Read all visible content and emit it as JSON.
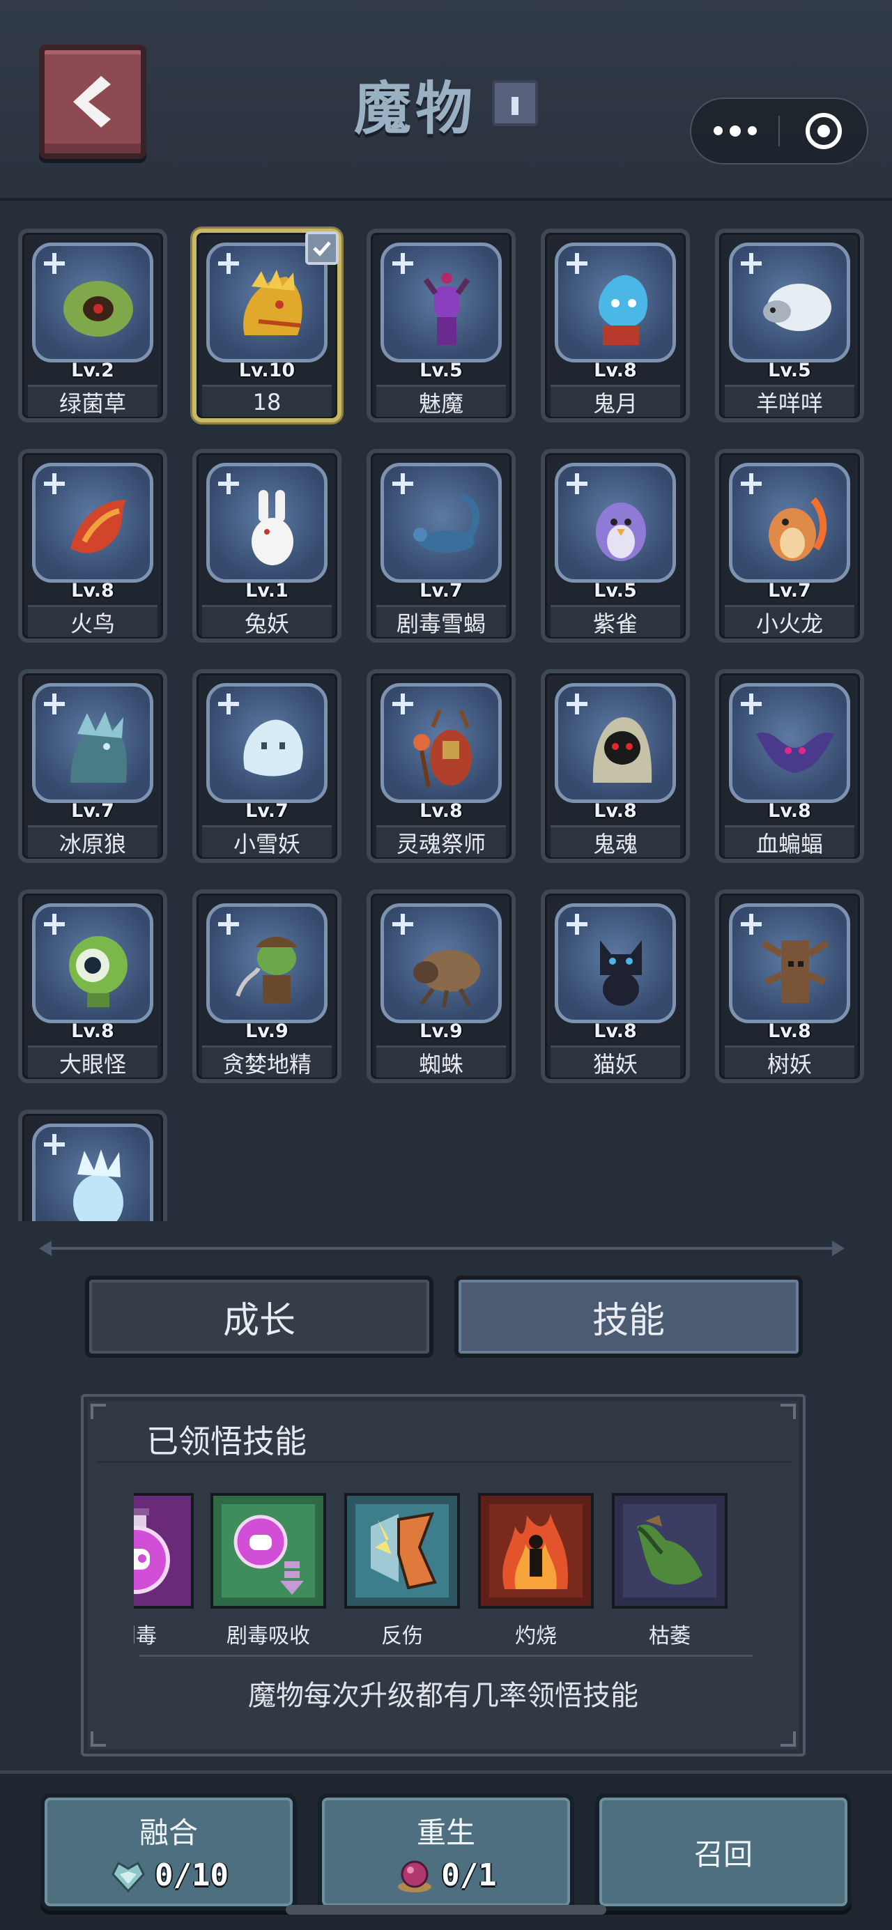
{
  "header": {
    "title": "魔物",
    "back_icon": "chevron-left-icon"
  },
  "monsters": [
    {
      "level": "Lv.2",
      "name": "绿菌草",
      "icon": "green-fungus-icon"
    },
    {
      "level": "Lv.10",
      "name": "18",
      "icon": "golden-dragon-icon",
      "selected": true
    },
    {
      "level": "Lv.5",
      "name": "魅魔",
      "icon": "succubus-icon"
    },
    {
      "level": "Lv.8",
      "name": "鬼月",
      "icon": "blue-flame-ghost-icon"
    },
    {
      "level": "Lv.5",
      "name": "羊咩咩",
      "icon": "sheep-icon"
    },
    {
      "level": "Lv.8",
      "name": "火鸟",
      "icon": "fire-bird-icon"
    },
    {
      "level": "Lv.1",
      "name": "兔妖",
      "icon": "rabbit-icon"
    },
    {
      "level": "Lv.7",
      "name": "剧毒雪蝎",
      "icon": "scorpion-icon"
    },
    {
      "level": "Lv.5",
      "name": "紫雀",
      "icon": "purple-bird-icon"
    },
    {
      "level": "Lv.7",
      "name": "小火龙",
      "icon": "fire-dragon-icon"
    },
    {
      "level": "Lv.7",
      "name": "冰原狼",
      "icon": "ice-wolf-icon"
    },
    {
      "level": "Lv.7",
      "name": "小雪妖",
      "icon": "snow-ghost-icon"
    },
    {
      "level": "Lv.8",
      "name": "灵魂祭师",
      "icon": "soul-priest-icon"
    },
    {
      "level": "Lv.8",
      "name": "鬼魂",
      "icon": "hooded-ghost-icon"
    },
    {
      "level": "Lv.8",
      "name": "血蝙蝠",
      "icon": "bat-icon"
    },
    {
      "level": "Lv.8",
      "name": "大眼怪",
      "icon": "eyeball-icon"
    },
    {
      "level": "Lv.9",
      "name": "贪婪地精",
      "icon": "goblin-icon"
    },
    {
      "level": "Lv.9",
      "name": "蜘蛛",
      "icon": "spider-icon"
    },
    {
      "level": "Lv.8",
      "name": "猫妖",
      "icon": "black-cat-icon"
    },
    {
      "level": "Lv.8",
      "name": "树妖",
      "icon": "tree-monster-icon"
    },
    {
      "level": "",
      "name": "",
      "icon": "ice-golem-icon"
    }
  ],
  "tabs": {
    "growth": "成长",
    "skills": "技能"
  },
  "skills_panel": {
    "title": "已领悟技能",
    "skills": [
      {
        "name": "剧毒",
        "icon": "poison-potion-icon"
      },
      {
        "name": "剧毒吸收",
        "icon": "poison-absorb-icon"
      },
      {
        "name": "反伤",
        "icon": "reflect-shield-icon"
      },
      {
        "name": "灼烧",
        "icon": "burn-icon"
      },
      {
        "name": "枯萎",
        "icon": "wither-icon"
      }
    ],
    "hint": "魔物每次升级都有几率领悟技能"
  },
  "bottom_bar": {
    "fuse": {
      "label": "融合",
      "count": "0/10",
      "icon": "crystal-heart-icon"
    },
    "reborn": {
      "label": "重生",
      "count": "0/1",
      "icon": "purple-orb-icon"
    },
    "recall": {
      "label": "召回"
    }
  },
  "colors": {
    "background": "#262e3a",
    "selected_border": "#c9b865",
    "tab_active": "#4b5b72",
    "button": "#4e6f7f"
  }
}
